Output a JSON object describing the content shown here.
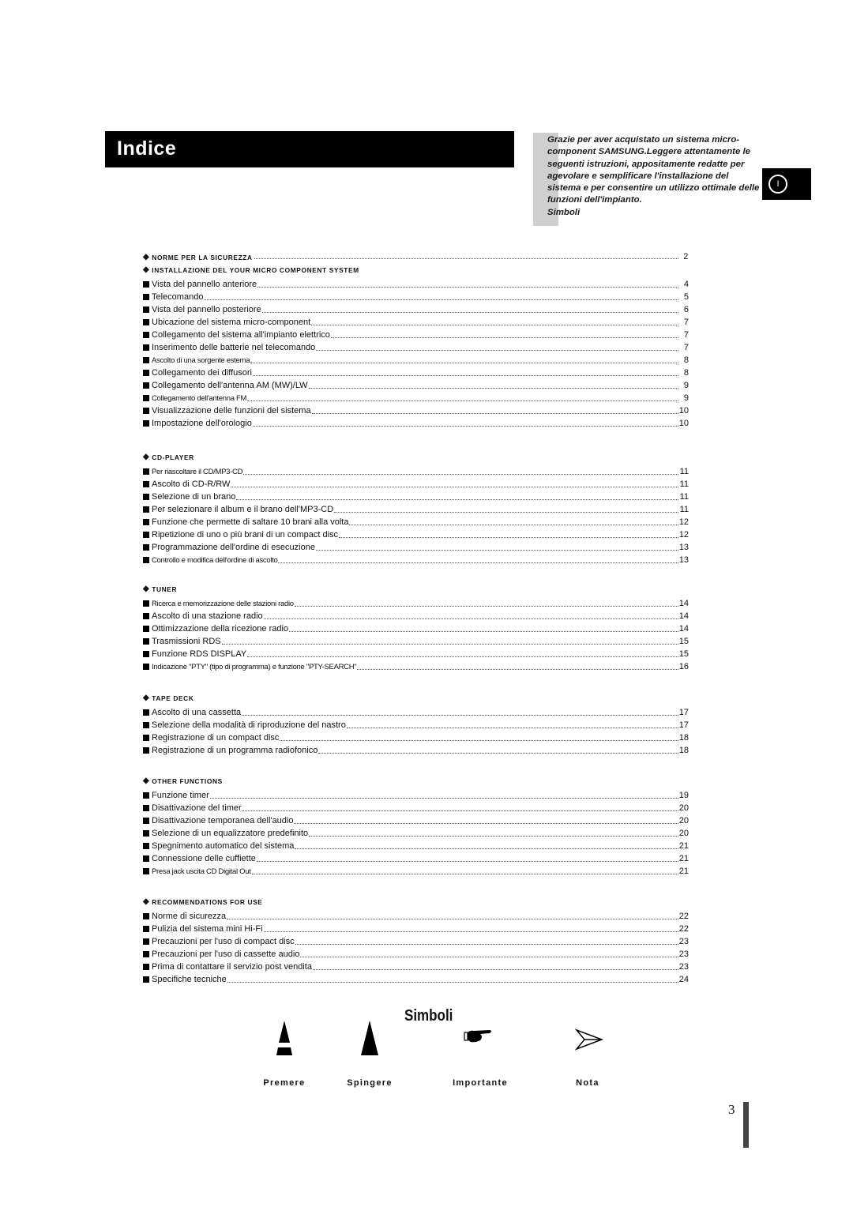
{
  "title": "Indice",
  "intro": {
    "text": "Grazie per aver acquistato un sistema micro-component SAMSUNG.Leggere attentamente le seguenti istruzioni, appositamente redatte per agevolare e semplificare l'installazione del sistema e per consentire un utilizzo ottimale delle funzioni dell'impianto.",
    "simboli": "Simboli"
  },
  "language_tab": "I",
  "sections": [
    {
      "header": "Norme per la sicurezza",
      "page": "2",
      "items": []
    },
    {
      "header": "Installazione del Your Micro Component System",
      "page": "",
      "items": [
        {
          "label": "Vista del pannello anteriore",
          "page": "4"
        },
        {
          "label": "Telecomando",
          "page": "5"
        },
        {
          "label": "Vista del pannello posteriore",
          "page": "6"
        },
        {
          "label": "Ubicazione del sistema micro-component",
          "page": "7"
        },
        {
          "label": "Collegamento del sistema all'impianto elettrico",
          "page": "7"
        },
        {
          "label": "Inserimento delle batterie nel telecomando",
          "page": "7"
        },
        {
          "label": "Ascolto di una sorgente esterna",
          "page": "8",
          "small": true
        },
        {
          "label": "Collegamento dei diffusori",
          "page": "8"
        },
        {
          "label": "Collegamento dell'antenna AM (MW)/LW",
          "page": "9"
        },
        {
          "label": "Collegamento dell'antenna FM",
          "page": "9",
          "small": true
        },
        {
          "label": "Visualizzazione delle funzioni del sistema",
          "page": "10"
        },
        {
          "label": "Impostazione dell'orologio",
          "page": "10"
        }
      ]
    },
    {
      "header": "CD-Player",
      "page": "",
      "items": [
        {
          "label": "Per riascoltare il CD/MP3-CD",
          "page": "11",
          "small": true
        },
        {
          "label": "Ascolto di CD-R/RW",
          "page": "11"
        },
        {
          "label": "Selezione di un brano",
          "page": "11"
        },
        {
          "label": "Per selezionare il album e il brano dell'MP3-CD",
          "page": "11"
        },
        {
          "label": "Funzione che permette di saltare 10 brani alla volta",
          "page": "12"
        },
        {
          "label": "Ripetizione di uno o più brani di un compact disc",
          "page": "12"
        },
        {
          "label": "Programmazione dell'ordine di esecuzione",
          "page": "13"
        },
        {
          "label": "Controllo e modifica dell'ordine di ascolto",
          "page": "13",
          "small": true
        }
      ]
    },
    {
      "header": "Tuner",
      "page": "",
      "items": [
        {
          "label": "Ricerca e memorizzazione delle stazioni radio",
          "page": "14",
          "small": true
        },
        {
          "label": "Ascolto di una stazione radio",
          "page": "14"
        },
        {
          "label": "Ottimizzazione della ricezione radio",
          "page": "14"
        },
        {
          "label": "Trasmissioni RDS",
          "page": "15"
        },
        {
          "label": "Funzione RDS DISPLAY",
          "page": "15"
        },
        {
          "label": "Indicazione \"PTY\" (tipo di programma) e funzione \"PTY-SEARCH\"",
          "page": "16",
          "small": true
        }
      ]
    },
    {
      "header": "Tape Deck",
      "page": "",
      "items": [
        {
          "label": "Ascolto di una cassetta",
          "page": "17"
        },
        {
          "label": "Selezione della modalità di riproduzione del nastro",
          "page": "17"
        },
        {
          "label": "Registrazione di un compact disc",
          "page": "18"
        },
        {
          "label": "Registrazione di un programma radiofonico",
          "page": "18"
        }
      ]
    },
    {
      "header": "Other Functions",
      "page": "",
      "items": [
        {
          "label": "Funzione timer",
          "page": "19"
        },
        {
          "label": "Disattivazione del timer",
          "page": "20"
        },
        {
          "label": "Disattivazione temporanea dell'audio",
          "page": "20"
        },
        {
          "label": "Selezione di un equalizzatore predefinito",
          "page": "20"
        },
        {
          "label": "Spegnimento automatico del sistema",
          "page": "21"
        },
        {
          "label": "Connessione delle cuffiette",
          "page": "21"
        },
        {
          "label": "Presa jack uscita CD Digital Out",
          "page": "21",
          "small": true
        }
      ]
    },
    {
      "header": "Recommendations for Use",
      "page": "",
      "items": [
        {
          "label": "Norme di sicurezza",
          "page": "22"
        },
        {
          "label": "Pulizia del sistema mini Hi-Fi",
          "page": "22"
        },
        {
          "label": "Precauzioni per l'uso di compact disc",
          "page": "23"
        },
        {
          "label": "Precauzioni per l'uso di cassette audio",
          "page": "23"
        },
        {
          "label": "Prima di contattare il servizio post vendita",
          "page": "23"
        },
        {
          "label": "Specifiche tecniche",
          "page": "24"
        }
      ]
    }
  ],
  "symbols": {
    "title": "Simboli",
    "items": [
      {
        "icon": "press-icon",
        "label": "Premere"
      },
      {
        "icon": "push-icon",
        "label": "Spingere"
      },
      {
        "icon": "pointing-hand-icon",
        "label": "Importante"
      },
      {
        "icon": "arrow-note-icon",
        "label": "Nota"
      }
    ]
  },
  "page_number": "3"
}
